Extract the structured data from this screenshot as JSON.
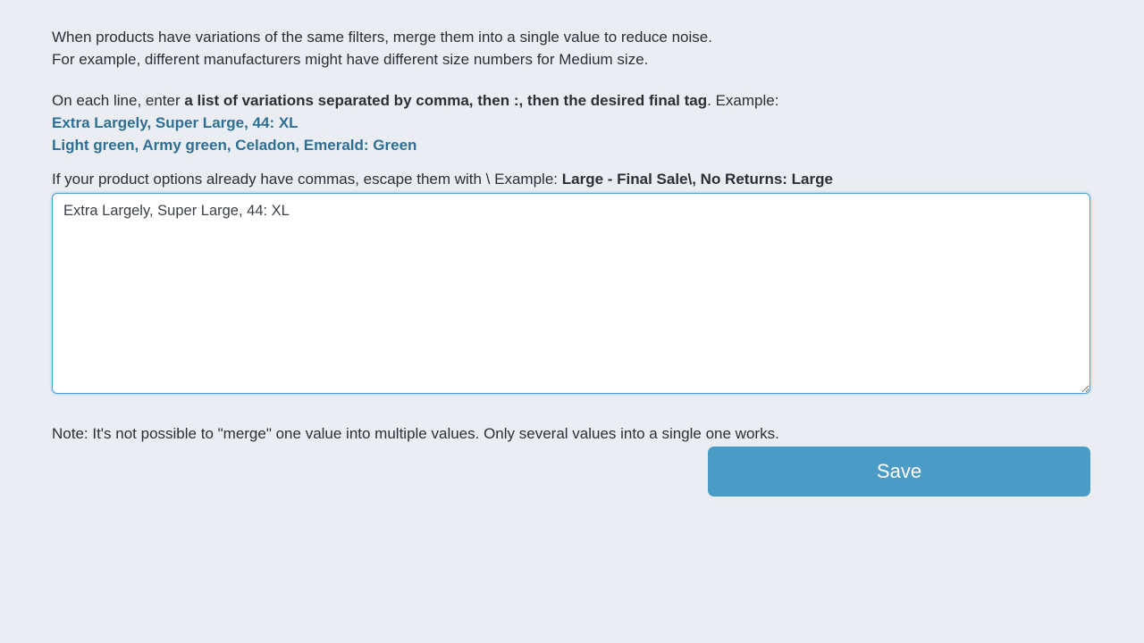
{
  "intro": {
    "line1": "When products have variations of the same filters, merge them into a single value to reduce noise.",
    "line2": "For example, different manufacturers might have different size numbers for Medium size."
  },
  "instructions": {
    "prefix": "On each line, enter ",
    "bold": "a list of variations separated by comma, then :, then the desired final tag",
    "suffix": ". Example:"
  },
  "examples": {
    "ex1": "Extra Largely, Super Large, 44: XL",
    "ex2": "Light green, Army green, Celadon, Emerald: Green"
  },
  "escape": {
    "prefix": "If your product options already have commas, escape them with \\   Example: ",
    "bold": "Large - Final Sale\\, No Returns: Large"
  },
  "textarea": {
    "value": "Extra Largely, Super Large, 44: XL"
  },
  "note": "Note: It's not possible to \"merge\" one value into multiple values. Only several values into a single one works.",
  "buttons": {
    "save": "Save"
  }
}
